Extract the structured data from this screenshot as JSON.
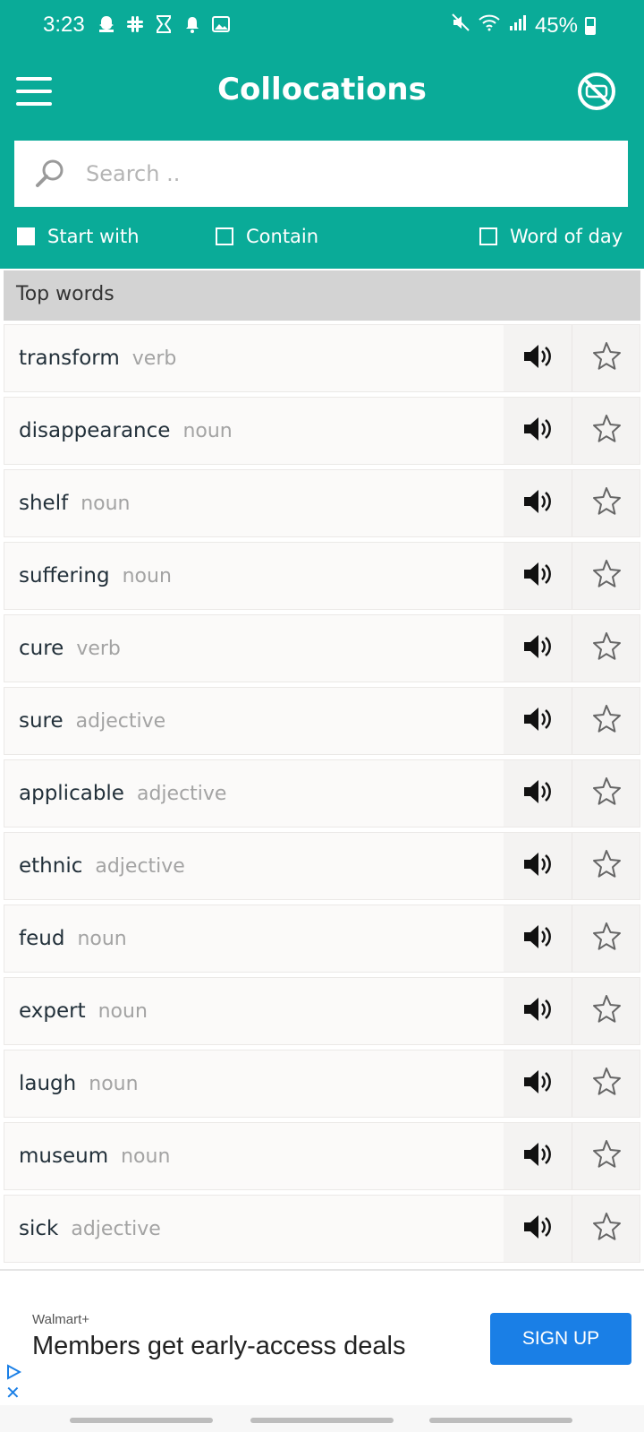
{
  "status_bar": {
    "time": "3:23",
    "battery": "45%",
    "battery_level": 0.45
  },
  "app_bar": {
    "title": "Collocations"
  },
  "search": {
    "placeholder": "Search ..",
    "value": ""
  },
  "filters": [
    {
      "label": "Start with",
      "checked": true
    },
    {
      "label": "Contain",
      "checked": false
    },
    {
      "label": "Word of day",
      "checked": false
    }
  ],
  "section_title": "Top words",
  "words": [
    {
      "word": "transform",
      "pos": "verb"
    },
    {
      "word": "disappearance",
      "pos": "noun"
    },
    {
      "word": "shelf",
      "pos": "noun"
    },
    {
      "word": "suffering",
      "pos": "noun"
    },
    {
      "word": "cure",
      "pos": "verb"
    },
    {
      "word": "sure",
      "pos": "adjective"
    },
    {
      "word": "applicable",
      "pos": "adjective"
    },
    {
      "word": "ethnic",
      "pos": "adjective"
    },
    {
      "word": "feud",
      "pos": "noun"
    },
    {
      "word": "expert",
      "pos": "noun"
    },
    {
      "word": "laugh",
      "pos": "noun"
    },
    {
      "word": "museum",
      "pos": "noun"
    },
    {
      "word": "sick",
      "pos": "adjective"
    }
  ],
  "ad": {
    "advertiser": "Walmart+",
    "headline": "Members get early-access deals",
    "cta": "SIGN UP"
  },
  "colors": {
    "primary": "#0aab98",
    "ad_button": "#1a7fe6"
  },
  "icons": [
    "menu-icon",
    "no-ads-icon",
    "search-icon",
    "speaker-icon",
    "star-icon",
    "ad-choices-icon",
    "close-icon"
  ]
}
